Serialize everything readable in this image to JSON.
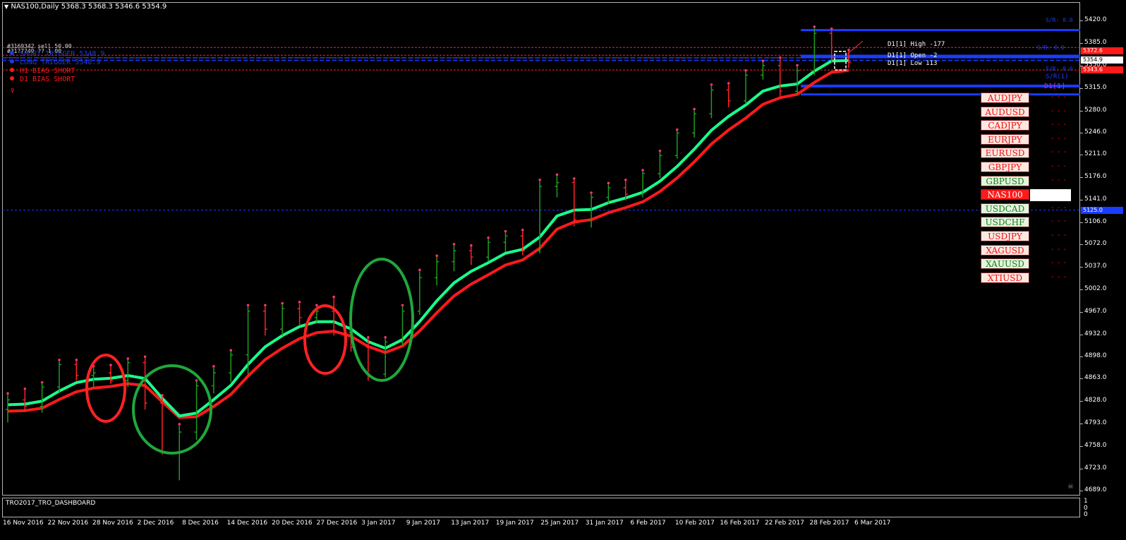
{
  "window": {
    "symbol_line": "NAS100,Daily  5368.3 5368.3 5346.6 5354.9"
  },
  "legend": {
    "order_line": "#3169342 sell 50.00",
    "order_line2": "#31?7?49 ?? 1.00",
    "rows": [
      {
        "text": "SHORT TRIGGER  5348.9",
        "color": "#1f3bdc"
      },
      {
        "text": "LONG TRIGGER   5348.9",
        "color": "#1f3bdc"
      },
      {
        "text": "H1 BIAS SHORT",
        "color": "#ff1a1a"
      },
      {
        "text": "D1 BIAS SHORT",
        "color": "#ff1a1a"
      }
    ],
    "small_mark": "♀"
  },
  "d1_box": {
    "high": "D1[1] High  -177",
    "open": "D1[1] Open  -2",
    "low": "D1[1] Low  113",
    "tag": "D1[1]",
    "res_label": "S/R: 0.0",
    "res_label2": "S/R: 0.0",
    "sup_label": "S/R: 0.0",
    "sup_label2": "S/R(1)"
  },
  "symbols": [
    {
      "label": "AUDJPY",
      "color": "#e11",
      "bg": "#fde7e1"
    },
    {
      "label": "AUDUSD",
      "color": "#e11",
      "bg": "#fde7e1"
    },
    {
      "label": "CADJPY",
      "color": "#e11",
      "bg": "#fde7e1"
    },
    {
      "label": "EURJPY",
      "color": "#e11",
      "bg": "#fde7e1"
    },
    {
      "label": "EURUSD",
      "color": "#e11",
      "bg": "#fde7e1"
    },
    {
      "label": "GBPJPY",
      "color": "#e11",
      "bg": "#fde7e1"
    },
    {
      "label": "GBPUSD",
      "color": "#1b7a1b",
      "bg": "#e3f5df"
    },
    {
      "label": "NAS100",
      "color": "#ffffff",
      "bg": "#ff1a1a"
    },
    {
      "label": "USDCAD",
      "color": "#1b7a1b",
      "bg": "#e3f5df"
    },
    {
      "label": "USDCHF",
      "color": "#1b7a1b",
      "bg": "#e3f5df"
    },
    {
      "label": "USDJPY",
      "color": "#e11",
      "bg": "#fde7e1"
    },
    {
      "label": "XAGUSD",
      "color": "#e11",
      "bg": "#fde7e1"
    },
    {
      "label": "XAUUSD",
      "color": "#1b7a1b",
      "bg": "#e3f5df"
    },
    {
      "label": "XTIUSD",
      "color": "#e11",
      "bg": "#fde7e1"
    }
  ],
  "symbol_dash": "- - -",
  "price_labels": {
    "upper_red": "5372.6",
    "current": "5354.9",
    "lower_red": "5343.6",
    "blue_line": "5125.0"
  },
  "subwindow": {
    "title": "TRO2017_TRO_DASHBOARD",
    "axis_top": "1",
    "axis_mid": "0",
    "axis_bottom": "0"
  },
  "colors": {
    "bull_candle": "#1f9c1f",
    "bear_candle": "#ff2222",
    "fast_ma": "#19ff8c",
    "slow_ma": "#ff1a1a",
    "blue_levels": "#1a3cff",
    "red_levels": "#ff2222",
    "circle_green": "#1fa83a",
    "circle_red": "#ff2222"
  },
  "chart_data": {
    "type": "candlestick",
    "title": "NAS100,Daily",
    "y_ticks": [
      "5420.0",
      "5385.0",
      "5350.0",
      "5315.0",
      "5280.0",
      "5246.0",
      "5211.0",
      "5176.0",
      "5141.0",
      "5106.0",
      "5072.0",
      "5037.0",
      "5002.0",
      "4967.0",
      "4932.0",
      "4898.0",
      "4863.0",
      "4828.0",
      "4793.0",
      "4758.0",
      "4723.0",
      "4689.0"
    ],
    "x_ticks": [
      "16 Nov 2016",
      "22 Nov 2016",
      "28 Nov 2016",
      "2 Dec 2016",
      "8 Dec 2016",
      "14 Dec 2016",
      "20 Dec 2016",
      "27 Dec 2016",
      "3 Jan 2017",
      "9 Jan 2017",
      "13 Jan 2017",
      "19 Jan 2017",
      "25 Jan 2017",
      "31 Jan 2017",
      "6 Feb 2017",
      "10 Feb 2017",
      "16 Feb 2017",
      "22 Feb 2017",
      "28 Feb 2017",
      "6 Mar 2017"
    ],
    "ylim": [
      4689,
      5420
    ],
    "candles": [
      {
        "o": 4815,
        "h": 4838,
        "l": 4795,
        "c": 4830,
        "dir": "up"
      },
      {
        "o": 4830,
        "h": 4845,
        "l": 4812,
        "c": 4820,
        "dir": "down"
      },
      {
        "o": 4820,
        "h": 4855,
        "l": 4810,
        "c": 4850,
        "dir": "up"
      },
      {
        "o": 4850,
        "h": 4890,
        "l": 4842,
        "c": 4885,
        "dir": "up"
      },
      {
        "o": 4885,
        "h": 4890,
        "l": 4860,
        "c": 4868,
        "dir": "down"
      },
      {
        "o": 4868,
        "h": 4880,
        "l": 4850,
        "c": 4872,
        "dir": "up"
      },
      {
        "o": 4872,
        "h": 4882,
        "l": 4855,
        "c": 4860,
        "dir": "down"
      },
      {
        "o": 4860,
        "h": 4892,
        "l": 4850,
        "c": 4888,
        "dir": "up"
      },
      {
        "o": 4888,
        "h": 4895,
        "l": 4815,
        "c": 4825,
        "dir": "down"
      },
      {
        "o": 4825,
        "h": 4835,
        "l": 4745,
        "c": 4748,
        "dir": "down"
      },
      {
        "o": 4748,
        "h": 4790,
        "l": 4705,
        "c": 4780,
        "dir": "up"
      },
      {
        "o": 4780,
        "h": 4858,
        "l": 4768,
        "c": 4852,
        "dir": "up"
      },
      {
        "o": 4852,
        "h": 4880,
        "l": 4840,
        "c": 4872,
        "dir": "up"
      },
      {
        "o": 4872,
        "h": 4905,
        "l": 4858,
        "c": 4900,
        "dir": "up"
      },
      {
        "o": 4900,
        "h": 4975,
        "l": 4870,
        "c": 4968,
        "dir": "up"
      },
      {
        "o": 4968,
        "h": 4975,
        "l": 4930,
        "c": 4940,
        "dir": "down"
      },
      {
        "o": 4940,
        "h": 4978,
        "l": 4930,
        "c": 4972,
        "dir": "up"
      },
      {
        "o": 4972,
        "h": 4980,
        "l": 4945,
        "c": 4958,
        "dir": "down"
      },
      {
        "o": 4958,
        "h": 4975,
        "l": 4950,
        "c": 4968,
        "dir": "up"
      },
      {
        "o": 4968,
        "h": 4988,
        "l": 4930,
        "c": 4935,
        "dir": "down"
      },
      {
        "o": 4935,
        "h": 4945,
        "l": 4905,
        "c": 4912,
        "dir": "down"
      },
      {
        "o": 4912,
        "h": 4925,
        "l": 4860,
        "c": 4870,
        "dir": "down"
      },
      {
        "o": 4870,
        "h": 4925,
        "l": 4865,
        "c": 4920,
        "dir": "up"
      },
      {
        "o": 4920,
        "h": 4975,
        "l": 4915,
        "c": 4968,
        "dir": "up"
      },
      {
        "o": 4968,
        "h": 5030,
        "l": 4962,
        "c": 5020,
        "dir": "up"
      },
      {
        "o": 5020,
        "h": 5052,
        "l": 5008,
        "c": 5045,
        "dir": "up"
      },
      {
        "o": 5045,
        "h": 5070,
        "l": 5030,
        "c": 5062,
        "dir": "up"
      },
      {
        "o": 5062,
        "h": 5068,
        "l": 5040,
        "c": 5052,
        "dir": "down"
      },
      {
        "o": 5052,
        "h": 5080,
        "l": 5045,
        "c": 5075,
        "dir": "up"
      },
      {
        "o": 5075,
        "h": 5090,
        "l": 5060,
        "c": 5085,
        "dir": "up"
      },
      {
        "o": 5085,
        "h": 5092,
        "l": 5055,
        "c": 5062,
        "dir": "down"
      },
      {
        "o": 5062,
        "h": 5170,
        "l": 5058,
        "c": 5162,
        "dir": "up"
      },
      {
        "o": 5162,
        "h": 5178,
        "l": 5145,
        "c": 5168,
        "dir": "up"
      },
      {
        "o": 5168,
        "h": 5172,
        "l": 5100,
        "c": 5110,
        "dir": "down"
      },
      {
        "o": 5110,
        "h": 5150,
        "l": 5098,
        "c": 5145,
        "dir": "up"
      },
      {
        "o": 5145,
        "h": 5165,
        "l": 5135,
        "c": 5160,
        "dir": "up"
      },
      {
        "o": 5160,
        "h": 5170,
        "l": 5140,
        "c": 5150,
        "dir": "down"
      },
      {
        "o": 5150,
        "h": 5185,
        "l": 5145,
        "c": 5182,
        "dir": "up"
      },
      {
        "o": 5182,
        "h": 5215,
        "l": 5175,
        "c": 5210,
        "dir": "up"
      },
      {
        "o": 5210,
        "h": 5248,
        "l": 5205,
        "c": 5245,
        "dir": "up"
      },
      {
        "o": 5245,
        "h": 5280,
        "l": 5238,
        "c": 5275,
        "dir": "up"
      },
      {
        "o": 5275,
        "h": 5318,
        "l": 5268,
        "c": 5312,
        "dir": "up"
      },
      {
        "o": 5312,
        "h": 5320,
        "l": 5285,
        "c": 5295,
        "dir": "down"
      },
      {
        "o": 5295,
        "h": 5340,
        "l": 5290,
        "c": 5335,
        "dir": "up"
      },
      {
        "o": 5335,
        "h": 5355,
        "l": 5328,
        "c": 5350,
        "dir": "up"
      },
      {
        "o": 5350,
        "h": 5360,
        "l": 5300,
        "c": 5310,
        "dir": "down"
      },
      {
        "o": 5310,
        "h": 5348,
        "l": 5305,
        "c": 5342,
        "dir": "up"
      },
      {
        "o": 5342,
        "h": 5408,
        "l": 5335,
        "c": 5400,
        "dir": "up"
      },
      {
        "o": 5400,
        "h": 5405,
        "l": 5355,
        "c": 5362,
        "dir": "down"
      },
      {
        "o": 5362,
        "h": 5372,
        "l": 5346,
        "c": 5355,
        "dir": "down"
      }
    ]
  }
}
